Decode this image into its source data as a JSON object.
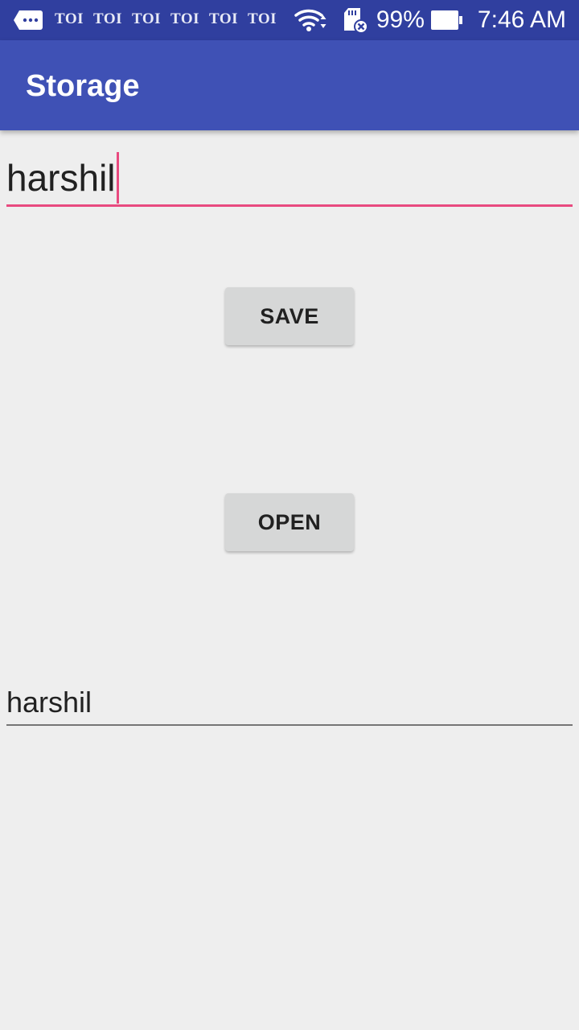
{
  "status_bar": {
    "background": "#303f9f",
    "notification_icons": [
      "TOI",
      "TOI",
      "TOI",
      "TOI",
      "TOI",
      "TOI"
    ],
    "message_icon": "message-icon",
    "wifi_icon": "wifi-icon",
    "sd_icon": "sd-card-error-icon",
    "battery_percent": "99%",
    "battery_icon": "battery-icon",
    "time": "7:46 AM"
  },
  "app_bar": {
    "title": "Storage",
    "background": "#3f51b5"
  },
  "input": {
    "value": "harshil",
    "accent": "#e84a7f"
  },
  "buttons": {
    "save_label": "SAVE",
    "open_label": "OPEN"
  },
  "output": {
    "value": "harshil"
  }
}
